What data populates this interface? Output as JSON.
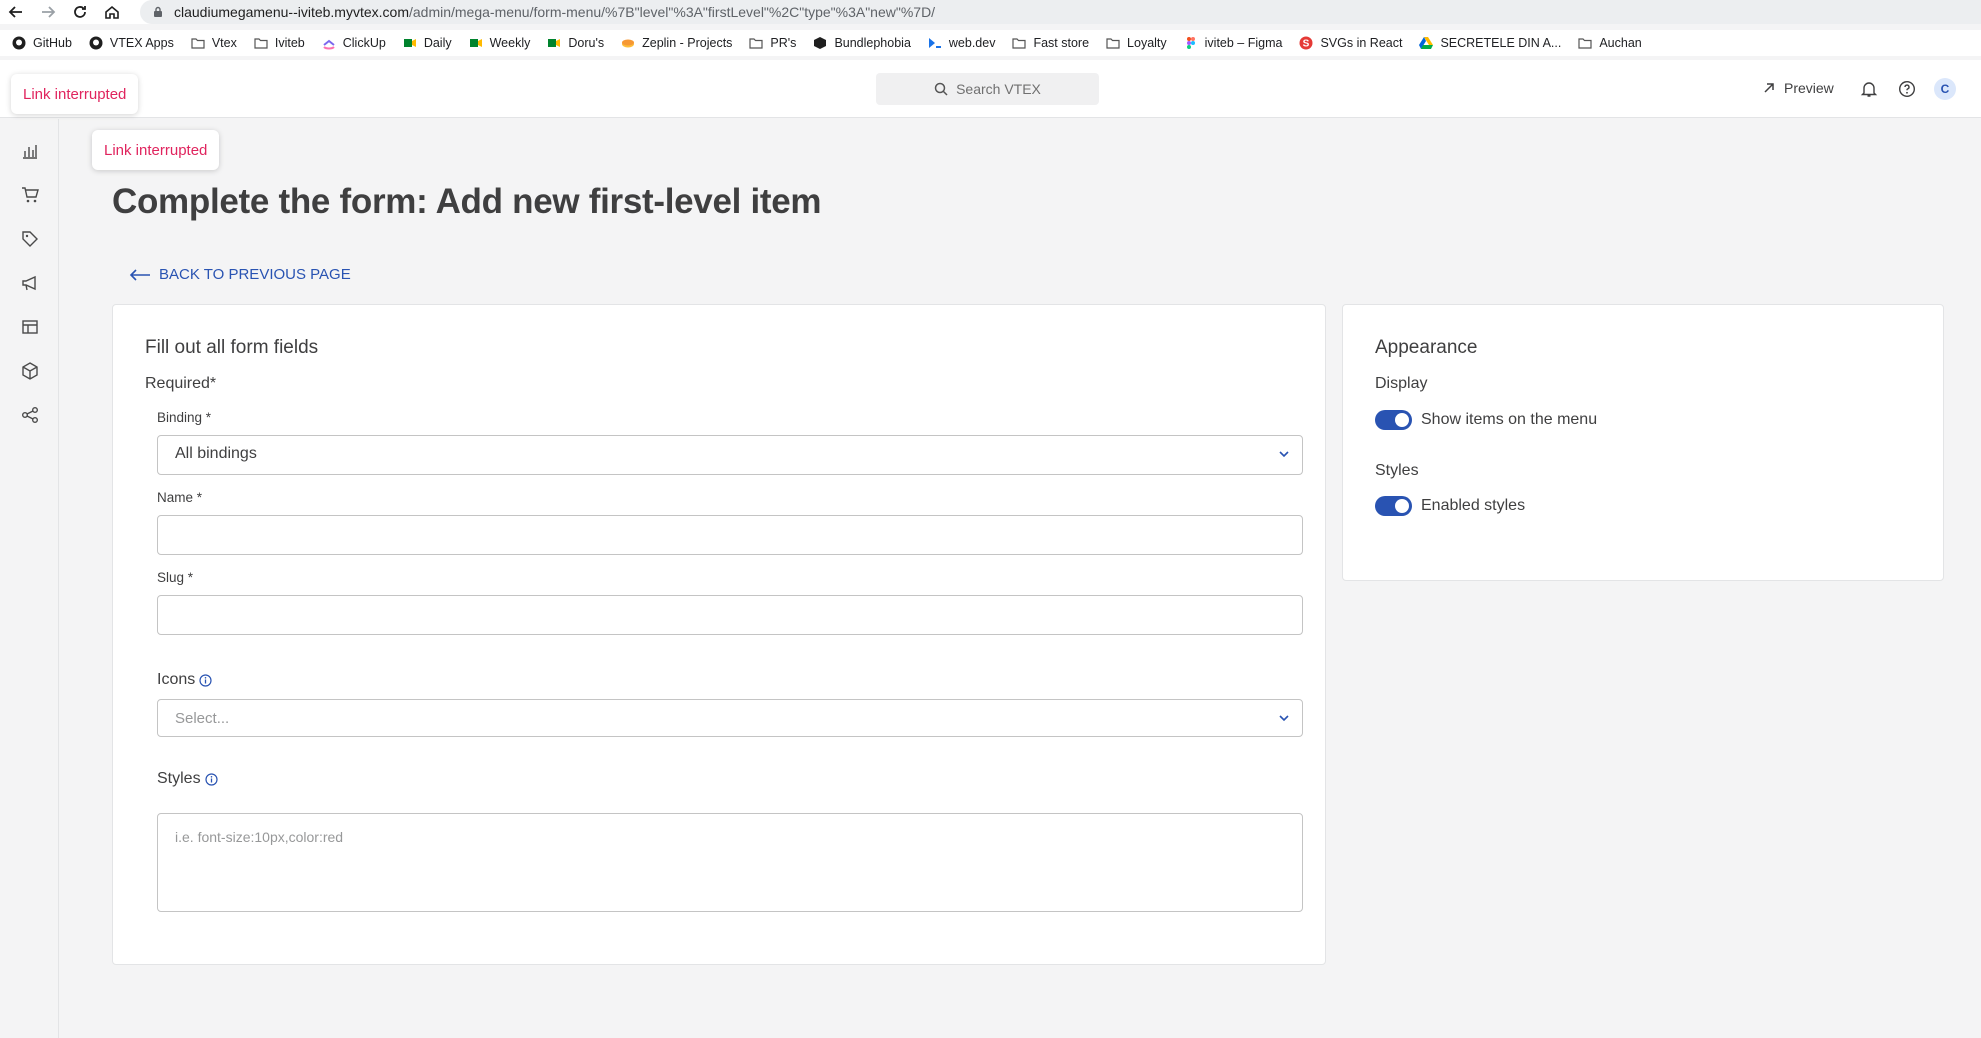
{
  "browser": {
    "url_host": "claudiumegamenu--iviteb.myvtex.com",
    "url_path": "/admin/mega-menu/form-menu/%7B\"level\"%3A\"firstLevel\"%2C\"type\"%3A\"new\"%7D/",
    "bookmarks": [
      {
        "label": "GitHub",
        "icon": "github-icon"
      },
      {
        "label": "VTEX Apps",
        "icon": "github-icon"
      },
      {
        "label": "Vtex",
        "icon": "folder-icon"
      },
      {
        "label": "Iviteb",
        "icon": "folder-icon"
      },
      {
        "label": "ClickUp",
        "icon": "clickup-icon"
      },
      {
        "label": "Daily",
        "icon": "meet-icon"
      },
      {
        "label": "Weekly",
        "icon": "meet-icon"
      },
      {
        "label": "Doru's",
        "icon": "meet-icon"
      },
      {
        "label": "Zeplin - Projects",
        "icon": "zeplin-icon"
      },
      {
        "label": "PR's",
        "icon": "folder-icon"
      },
      {
        "label": "Bundlephobia",
        "icon": "box-icon"
      },
      {
        "label": "web.dev",
        "icon": "webdev-icon"
      },
      {
        "label": "Fast store",
        "icon": "folder-icon"
      },
      {
        "label": "Loyalty",
        "icon": "folder-icon"
      },
      {
        "label": "iviteb – Figma",
        "icon": "figma-icon"
      },
      {
        "label": "SVGs in React",
        "icon": "s-icon"
      },
      {
        "label": "SECRETELE DIN A...",
        "icon": "drive-icon"
      },
      {
        "label": "Auchan",
        "icon": "folder-icon"
      }
    ]
  },
  "header": {
    "search_placeholder": "Search VTEX",
    "preview_label": "Preview",
    "avatar_initial": "C"
  },
  "toasts": {
    "top": "Link interrupted",
    "content": "Link interrupted"
  },
  "page": {
    "title": "Complete the form: Add new first-level item",
    "back_label": "BACK TO PREVIOUS PAGE"
  },
  "form": {
    "heading": "Fill out all form fields",
    "required_label": "Required*",
    "binding": {
      "label": "Binding *",
      "value": "All bindings"
    },
    "name": {
      "label": "Name *",
      "value": ""
    },
    "slug": {
      "label": "Slug *",
      "value": ""
    },
    "icons": {
      "label": "Icons",
      "placeholder": "Select..."
    },
    "styles": {
      "label": "Styles",
      "placeholder": "i.e. font-size:10px,color:red"
    }
  },
  "appearance": {
    "heading": "Appearance",
    "display_label": "Display",
    "display_toggle": {
      "label": "Show items on the menu",
      "checked": true
    },
    "styles_label": "Styles",
    "styles_toggle": {
      "label": "Enabled styles",
      "checked": true
    }
  },
  "colors": {
    "accent": "#2953b2",
    "toast_text": "#e0245e",
    "background": "#f4f4f5"
  }
}
